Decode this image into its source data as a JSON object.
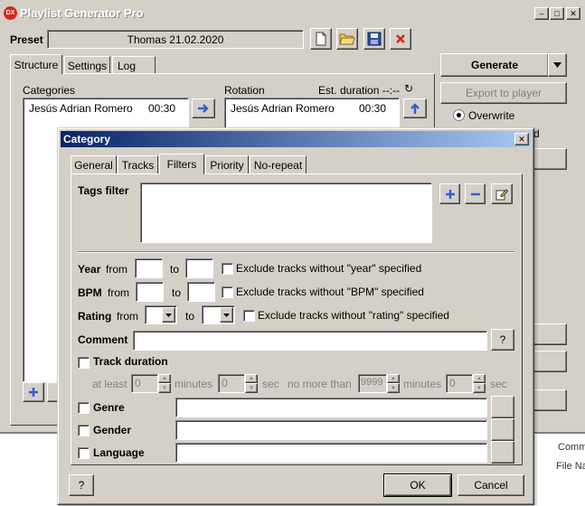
{
  "main_window": {
    "title": "Playlist Generator Pro",
    "app_icon_text": "DX",
    "preset_label": "Preset",
    "preset_value": "Thomas 21.02.2020",
    "tabs": [
      "Structure",
      "Settings",
      "Log"
    ],
    "generate_label": "Generate",
    "export_label": "Export to player",
    "overwrite_label": "Overwrite",
    "categories_label": "Categories",
    "categories": [
      {
        "name": "Jesús Adrian Romero",
        "duration": "00:30"
      }
    ],
    "rotation_label": "Rotation",
    "est_duration_label": "Est. duration --:--",
    "rotation": [
      {
        "name": "Jesús Adrian Romero",
        "duration": "00:30"
      }
    ],
    "partial_letter": "d",
    "right_partial": [
      "Comm",
      "File Na"
    ]
  },
  "dialog": {
    "title": "Category",
    "tabs": [
      "General",
      "Tracks",
      "Filters",
      "Priority",
      "No-repeat"
    ],
    "tags_filter_label": "Tags filter",
    "year_label": "Year",
    "from_label": "from",
    "to_label": "to",
    "year_exclude": "Exclude tracks without \"year\" specified",
    "bpm_label": "BPM",
    "bpm_exclude": "Exclude tracks without \"BPM\" specified",
    "rating_label": "Rating",
    "rating_exclude": "Exclude tracks without \"rating\" specified",
    "comment_label": "Comment",
    "comment_help": "?",
    "track_duration_label": "Track duration",
    "at_least_label": "at least",
    "at_least_min": "0",
    "minutes_label": "minutes",
    "at_least_sec": "0",
    "sec_label": "sec",
    "no_more_than_label": "no more than",
    "max_min": "9999",
    "max_sec": "0",
    "genre_label": "Genre",
    "gender_label": "Gender",
    "language_label": "Language",
    "help_label": "?",
    "ok_label": "OK",
    "cancel_label": "Cancel"
  }
}
